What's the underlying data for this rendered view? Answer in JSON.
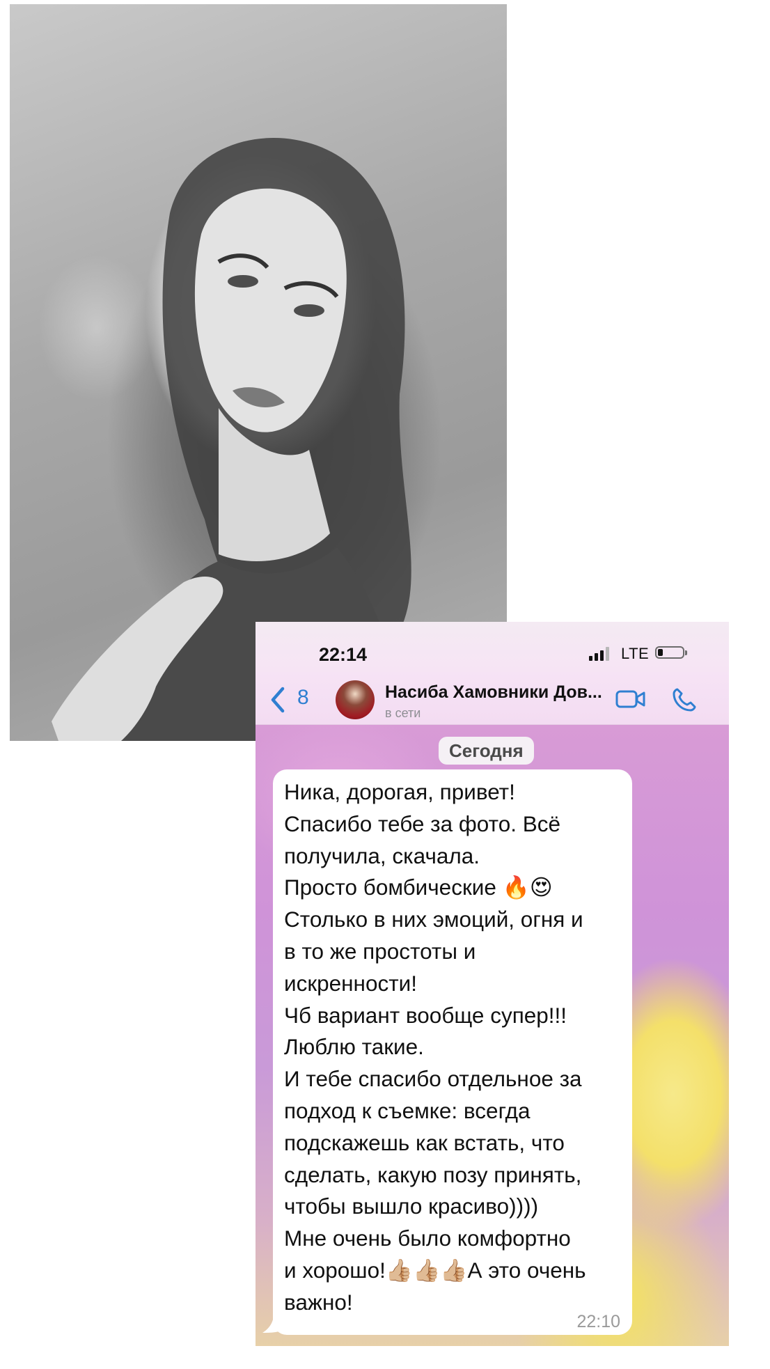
{
  "status_bar": {
    "time": "22:14",
    "network": "LTE"
  },
  "chat_header": {
    "back_count": "8",
    "contact_name": "Насиба Хамовники Дов...",
    "contact_status": "в сети",
    "icons": [
      "back-chevron-icon",
      "video-call-icon",
      "phone-call-icon"
    ]
  },
  "conversation": {
    "date_label": "Сегодня",
    "message": {
      "text": "Ника, дорогая, привет!\nСпасибо тебе за фото. Всё\nполучила, скачала.\nПросто бомбические 🔥😍\nСтолько в них эмоций, огня и\nв то же простоты и\nискренности!\nЧб вариант вообще супер!!!\nЛюблю такие.\nИ тебе спасибо отдельное за\nподход к съемке: всегда\nподскажешь как встать, что\nсделать, какую позу принять,\nчтобы вышло красиво))))\nМне очень было комфортно\nи хорошо!👍🏼👍🏼👍🏼А это очень\nважно!",
      "time": "22:10"
    }
  },
  "colors": {
    "accent": "#2f7fd1",
    "bubble": "#ffffff",
    "header_bg": "#f5e3f4"
  }
}
